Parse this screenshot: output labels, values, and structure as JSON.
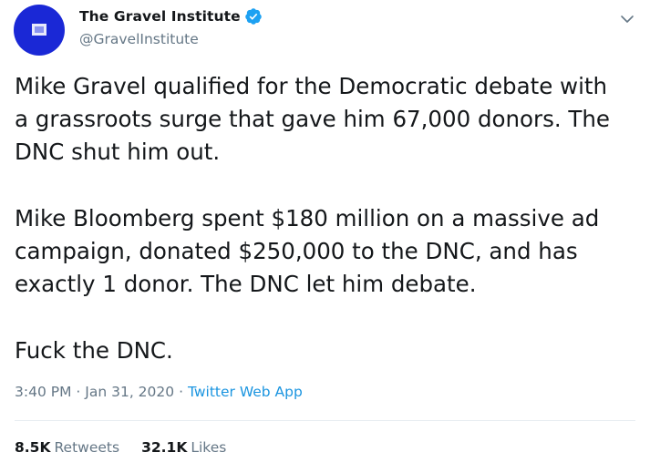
{
  "author": {
    "display_name": "The Gravel Institute",
    "handle": "@GravelInstitute",
    "verified_icon": "verified-badge-icon",
    "avatar_color": "#1a28d6"
  },
  "tweet": {
    "paragraphs": [
      [
        "Mike Gravel qualified for the Democratic debate with",
        "a grassroots surge that gave him 67,000 donors. The",
        "DNC shut him out."
      ],
      [
        "Mike Bloomberg spent $180 million on a massive ad",
        "campaign, donated $250,000 to the DNC, and has",
        "exactly 1 donor. The DNC let him debate."
      ],
      [
        "Fuck the DNC."
      ]
    ],
    "time": "3:40 PM",
    "separator": "·",
    "date": "Jan 31, 2020",
    "source": "Twitter Web App"
  },
  "stats": {
    "retweets_count": "8.5K",
    "retweets_label": "Retweets",
    "likes_count": "32.1K",
    "likes_label": "Likes"
  },
  "colors": {
    "link": "#1b95e0",
    "muted": "#657786",
    "verified": "#1da1f2"
  }
}
